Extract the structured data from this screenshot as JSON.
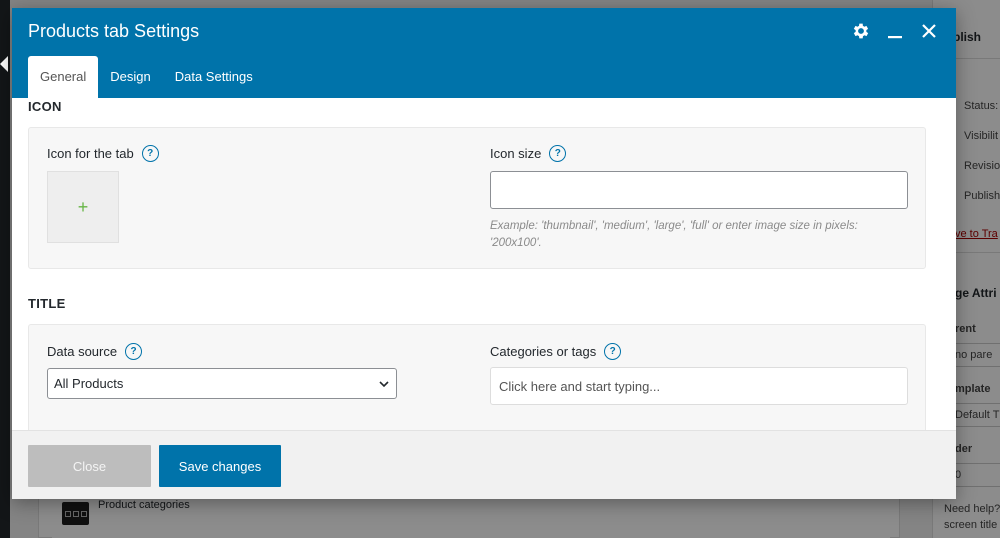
{
  "modal": {
    "title": "Products tab Settings",
    "tabs": [
      {
        "label": "General",
        "active": true
      },
      {
        "label": "Design",
        "active": false
      },
      {
        "label": "Data Settings",
        "active": false
      }
    ],
    "icons": [
      "gear-icon",
      "minimize-icon",
      "close-icon"
    ],
    "sections": {
      "icon": {
        "title": "ICON",
        "icon_for_tab_label": "Icon for the tab",
        "add_symbol": "+",
        "icon_size_label": "Icon size",
        "icon_size_value": "",
        "icon_size_hint": "Example: 'thumbnail', 'medium', 'large', 'full' or enter image size in pixels: '200x100'."
      },
      "title": {
        "title": "TITLE",
        "data_source_label": "Data source",
        "data_source_value": "All Products",
        "categories_label": "Categories or tags",
        "categories_placeholder": "Click here and start typing..."
      }
    },
    "help_symbol": "?",
    "footer": {
      "close_label": "Close",
      "save_label": "Save changes"
    }
  },
  "background": {
    "product_categories_label": "Product categories",
    "sidebar": {
      "publish": "blish",
      "status": "Status:",
      "visibility": "Visibilit",
      "revisions": "Revisio",
      "publish_item": "Publish",
      "trash": "ve to Tra",
      "page_attributes": "ge Attri",
      "parent": "rent",
      "parent_value": "no pare",
      "template": "mplate",
      "template_value": "Default T",
      "order": "der",
      "order_value": "0",
      "help_line1": "Need help?",
      "help_line2": "screen title"
    }
  },
  "colors": {
    "brand": "#0073aa",
    "close_button": "#bdbdbd",
    "plus": "#67b545"
  }
}
